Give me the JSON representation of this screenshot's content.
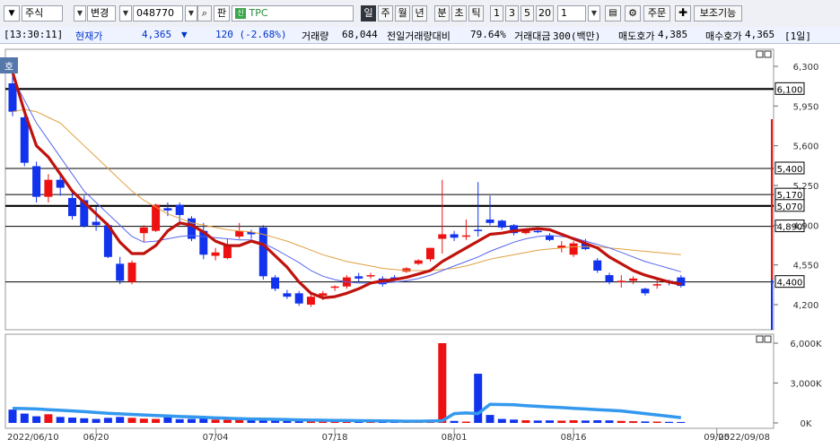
{
  "toolbar": {
    "market": "주식",
    "change_label": "변경",
    "code": "048770",
    "sell_label": "판",
    "stock_name": "TPC",
    "periods": [
      "일",
      "주",
      "월",
      "년",
      "분",
      "초",
      "틱"
    ],
    "intervals": [
      "1",
      "3",
      "5",
      "20"
    ],
    "count": "1",
    "order_label": "주문",
    "aux_label": "보조기능"
  },
  "ticker": {
    "time": "[13:30:11]",
    "price_label": "현재가",
    "price": "4,365",
    "arrow": "▼",
    "change": "120  (-2.68%)",
    "volume_label": "거래량",
    "volume": "68,044",
    "prev_ratio_label": "전일거래량대비",
    "prev_ratio": "79.64%",
    "amount_label": "거래대금",
    "amount": "300(백만)",
    "ask_label": "매도호가",
    "ask": "4,385",
    "bid_label": "매수호가",
    "bid": "4,365",
    "unit": "[1일]"
  },
  "price_axis": [
    "6,300",
    "5,950",
    "5,600",
    "5,250",
    "4,900",
    "4,550",
    "4,200"
  ],
  "volume_axis": [
    "6,000K",
    "3,000K",
    "0K"
  ],
  "level_labels": [
    "6,100",
    "5,400",
    "5,170",
    "5,070",
    "4,890",
    "4,400"
  ],
  "date_labels": [
    "2022/06/10",
    "06/20",
    "07/04",
    "07/18",
    "08/01",
    "08/16",
    "09/05",
    "2022/09/08"
  ],
  "badge": "호",
  "colors": {
    "up": "#ee1111",
    "down": "#1133ee",
    "ma5": "#c0120c",
    "ma10": "#5566ee",
    "ma20": "#e0a040",
    "volume_ma": "#3399ee"
  },
  "chart_data": {
    "type": "candlestick",
    "x": [
      "2022/06/10",
      "",
      "",
      "",
      "",
      "",
      "",
      "",
      "",
      "",
      "",
      "",
      "",
      "",
      "",
      "",
      "",
      "",
      "",
      "",
      "",
      "",
      "",
      "",
      "",
      "",
      "",
      "",
      "",
      "",
      "",
      "",
      "",
      "",
      "",
      "",
      "",
      "",
      "",
      "",
      "",
      "",
      "",
      "",
      "",
      "",
      "",
      "",
      "",
      "",
      "",
      "",
      "",
      "",
      "",
      "",
      "",
      "",
      "2022/09/08"
    ],
    "candles": [
      [
        6150,
        6300,
        5860,
        5900
      ],
      [
        5850,
        5880,
        5420,
        5450
      ],
      [
        5420,
        5460,
        5100,
        5150
      ],
      [
        5150,
        5350,
        5100,
        5300
      ],
      [
        5300,
        5350,
        5160,
        5230
      ],
      [
        5140,
        5200,
        4950,
        4980
      ],
      [
        5120,
        5160,
        4880,
        4890
      ],
      [
        4930,
        5060,
        4850,
        4900
      ],
      [
        4900,
        4920,
        4610,
        4620
      ],
      [
        4560,
        4620,
        4380,
        4410
      ],
      [
        4400,
        4590,
        4380,
        4570
      ],
      [
        4830,
        4900,
        4750,
        4880
      ],
      [
        4850,
        5090,
        4840,
        5080
      ],
      [
        5050,
        5100,
        4980,
        5030
      ],
      [
        5080,
        5100,
        4900,
        4990
      ],
      [
        4960,
        4980,
        4760,
        4780
      ],
      [
        4850,
        4920,
        4600,
        4640
      ],
      [
        4630,
        4700,
        4590,
        4660
      ],
      [
        4610,
        4780,
        4600,
        4720
      ],
      [
        4800,
        4920,
        4780,
        4850
      ],
      [
        4840,
        4860,
        4780,
        4820
      ],
      [
        4880,
        4900,
        4420,
        4450
      ],
      [
        4440,
        4460,
        4320,
        4340
      ],
      [
        4300,
        4330,
        4250,
        4270
      ],
      [
        4300,
        4320,
        4190,
        4210
      ],
      [
        4200,
        4290,
        4180,
        4270
      ],
      [
        4280,
        4320,
        4240,
        4300
      ],
      [
        4350,
        4370,
        4320,
        4360
      ],
      [
        4360,
        4460,
        4340,
        4440
      ],
      [
        4450,
        4480,
        4400,
        4430
      ],
      [
        4450,
        4480,
        4430,
        4460
      ],
      [
        4430,
        4450,
        4360,
        4380
      ],
      [
        4440,
        4460,
        4410,
        4430
      ],
      [
        4490,
        4530,
        4480,
        4520
      ],
      [
        4560,
        4600,
        4550,
        4590
      ],
      [
        4600,
        4700,
        4580,
        4700
      ],
      [
        4780,
        5300,
        4650,
        4820
      ],
      [
        4820,
        4850,
        4760,
        4790
      ],
      [
        4800,
        4950,
        4770,
        4810
      ],
      [
        4860,
        5280,
        4800,
        4850
      ],
      [
        4950,
        5160,
        4900,
        4920
      ],
      [
        4940,
        4950,
        4860,
        4880
      ],
      [
        4900,
        4910,
        4810,
        4830
      ],
      [
        4830,
        4870,
        4820,
        4860
      ],
      [
        4850,
        4880,
        4830,
        4840
      ],
      [
        4810,
        4830,
        4760,
        4770
      ],
      [
        4700,
        4760,
        4660,
        4720
      ],
      [
        4640,
        4760,
        4620,
        4740
      ],
      [
        4740,
        4780,
        4680,
        4690
      ],
      [
        4590,
        4610,
        4480,
        4500
      ],
      [
        4460,
        4480,
        4380,
        4400
      ],
      [
        4400,
        4460,
        4350,
        4410
      ],
      [
        4410,
        4450,
        4380,
        4430
      ],
      [
        4340,
        4350,
        4280,
        4300
      ],
      [
        4380,
        4420,
        4340,
        4380
      ],
      [
        4410,
        4420,
        4370,
        4400
      ],
      [
        4440,
        4460,
        4350,
        4365
      ]
    ],
    "volume_values": [
      1000,
      700,
      500,
      650,
      450,
      400,
      350,
      300,
      380,
      450,
      380,
      320,
      300,
      420,
      280,
      300,
      350,
      250,
      230,
      290,
      220,
      240,
      200,
      180,
      170,
      160,
      150,
      140,
      130,
      120,
      110,
      110,
      100,
      130,
      120,
      200,
      6000,
      150,
      100,
      3700,
      600,
      300,
      250,
      200,
      180,
      190,
      170,
      200,
      180,
      200,
      190,
      150,
      130,
      110,
      100,
      80,
      70
    ],
    "ma5": [
      6250,
      5900,
      5600,
      5500,
      5350,
      5200,
      5100,
      5000,
      4900,
      4750,
      4650,
      4650,
      4720,
      4850,
      4920,
      4900,
      4840,
      4760,
      4720,
      4720,
      4760,
      4730,
      4630,
      4530,
      4400,
      4300,
      4260,
      4270,
      4300,
      4340,
      4390,
      4410,
      4420,
      4440,
      4470,
      4500,
      4580,
      4640,
      4700,
      4760,
      4820,
      4830,
      4850,
      4860,
      4870,
      4860,
      4820,
      4780,
      4740,
      4700,
      4620,
      4560,
      4500,
      4460,
      4430,
      4400,
      4380
    ],
    "ma10": [
      6200,
      6000,
      5800,
      5650,
      5500,
      5350,
      5200,
      5100,
      5000,
      4900,
      4800,
      4750,
      4760,
      4780,
      4800,
      4810,
      4800,
      4790,
      4780,
      4770,
      4770,
      4740,
      4690,
      4630,
      4570,
      4500,
      4450,
      4420,
      4400,
      4390,
      4390,
      4390,
      4400,
      4410,
      4430,
      4460,
      4500,
      4540,
      4580,
      4620,
      4670,
      4710,
      4750,
      4780,
      4800,
      4810,
      4800,
      4790,
      4760,
      4730,
      4700,
      4660,
      4620,
      4580,
      4550,
      4520,
      4490
    ],
    "ma20": [
      5900,
      5920,
      5900,
      5850,
      5800,
      5700,
      5600,
      5500,
      5400,
      5300,
      5200,
      5120,
      5060,
      5000,
      4960,
      4920,
      4900,
      4880,
      4860,
      4850,
      4840,
      4820,
      4790,
      4760,
      4720,
      4680,
      4640,
      4610,
      4580,
      4560,
      4540,
      4520,
      4510,
      4500,
      4500,
      4500,
      4510,
      4520,
      4540,
      4570,
      4600,
      4620,
      4640,
      4660,
      4680,
      4690,
      4700,
      4710,
      4710,
      4710,
      4700,
      4690,
      4680,
      4670,
      4660,
      4650,
      4640
    ],
    "volume_ma": [
      1100,
      1080,
      1050,
      1000,
      950,
      900,
      850,
      780,
      720,
      680,
      640,
      600,
      560,
      520,
      480,
      450,
      420,
      380,
      350,
      320,
      300,
      290,
      270,
      250,
      230,
      210,
      200,
      190,
      180,
      170,
      160,
      150,
      140,
      130,
      130,
      140,
      160,
      700,
      750,
      700,
      1400,
      1380,
      1360,
      1300,
      1250,
      1200,
      1150,
      1100,
      1050,
      1000,
      950,
      900,
      800,
      700,
      600,
      500,
      400
    ],
    "ylim": [
      4100,
      6400
    ],
    "vol_ylim": [
      0,
      6500
    ],
    "levels": [
      6100,
      5400,
      5170,
      5070,
      4890,
      4400
    ]
  }
}
